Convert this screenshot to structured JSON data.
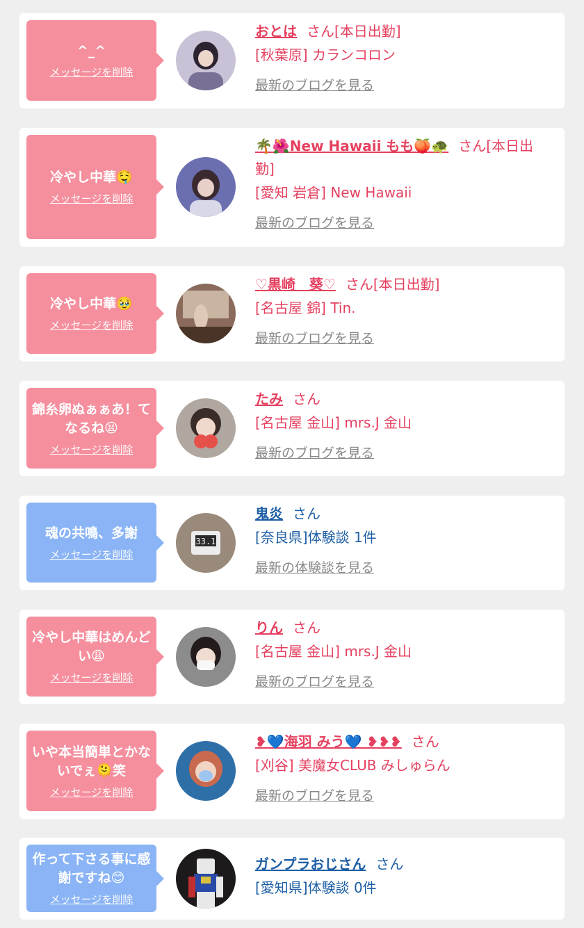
{
  "cards": [
    {
      "message": "^_^",
      "delete_label": "メッセージを削除",
      "name": "おとは",
      "suffix": "さん[本日出勤]",
      "location": "[秋葉原] カランコロン",
      "link": "最新のブログを見る",
      "bubble_color": "#f58f9e"
    },
    {
      "message": "冷やし中華🤤",
      "delete_label": "メッセージを削除",
      "name": "🌴🌺New Hawaii もも🍑🐢",
      "suffix": "さん[本日出勤]",
      "location": "[愛知 岩倉] New Hawaii",
      "link": "最新のブログを見る",
      "bubble_color": "#f58f9e"
    },
    {
      "message": "冷やし中華🥹",
      "delete_label": "メッセージを削除",
      "name": "♡黒崎　葵♡",
      "suffix": "さん[本日出勤]",
      "location": "[名古屋 錦] Tin.",
      "link": "最新のブログを見る",
      "bubble_color": "#f58f9e"
    },
    {
      "message": "錦糸卵ぬぁぁあ！てなるね😫",
      "delete_label": "メッセージを削除",
      "name": "たみ",
      "suffix": "さん",
      "location": "[名古屋 金山] mrs.J 金山",
      "link": "最新のブログを見る",
      "bubble_color": "#f58f9e"
    },
    {
      "message": "魂の共鳴、多謝",
      "delete_label": "メッセージを削除",
      "name": "鬼炎",
      "suffix": "さん",
      "location": "[奈良県]体験談 1件",
      "link": "最新の体験談を見る",
      "bubble_color": "#8ab4f5"
    },
    {
      "message": "冷やし中華はめんどい😩",
      "delete_label": "メッセージを削除",
      "name": "りん",
      "suffix": "さん",
      "location": "[名古屋 金山] mrs.J 金山",
      "link": "最新のブログを見る",
      "bubble_color": "#f58f9e"
    },
    {
      "message": "いや本当簡単とかないでぇ🫠笑",
      "delete_label": "メッセージを削除",
      "name": "❥💙海羽 みう💙 ❥❥❥",
      "suffix": "さん",
      "location": "[刈谷] 美魔女CLUB みしゅらん",
      "link": "最新のブログを見る",
      "bubble_color": "#f58f9e"
    },
    {
      "message": "作って下さる事に感謝ですね😊",
      "delete_label": "メッセージを削除",
      "name": "ガンプラおじさん",
      "suffix": "さん",
      "location": "[愛知県]体験談 0件",
      "link": "",
      "bubble_color": "#8ab4f5"
    }
  ]
}
